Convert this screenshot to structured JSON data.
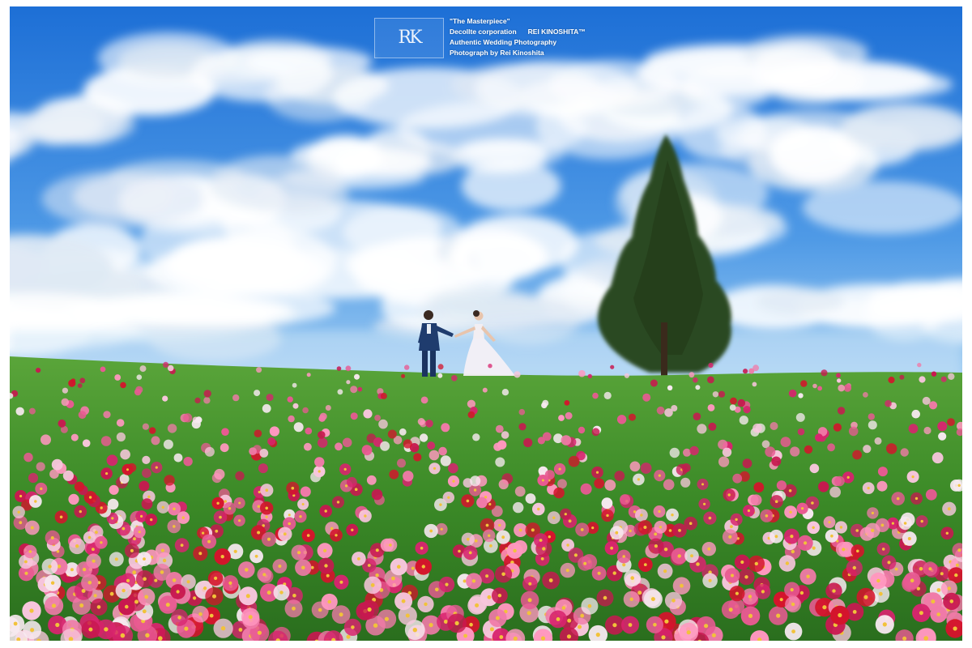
{
  "watermark": {
    "logo_text": "RK",
    "line1": "\"The Masterpiece\"",
    "line2a": "Decollte corporation",
    "line2b": "REI KINOSHITA™",
    "line3": "Authentic Wedding Photography",
    "line4": "Photograph by Rei Kinoshita"
  },
  "colors": {
    "sky_top": "#1f74d8",
    "sky_bottom": "#8cc3f0",
    "cloud": "#ffffff",
    "grass": "#3f8f2a",
    "tree": "#2f4a22",
    "flower_pink": "#f07aa8",
    "flower_magenta": "#d8246e",
    "flower_red": "#d4142c",
    "flower_white": "#f7e9f0"
  },
  "scene": {
    "subject": "couple-walking-hand-in-hand",
    "elements": [
      "sky",
      "clouds",
      "tree",
      "cosmos-field",
      "groom",
      "bride"
    ]
  }
}
